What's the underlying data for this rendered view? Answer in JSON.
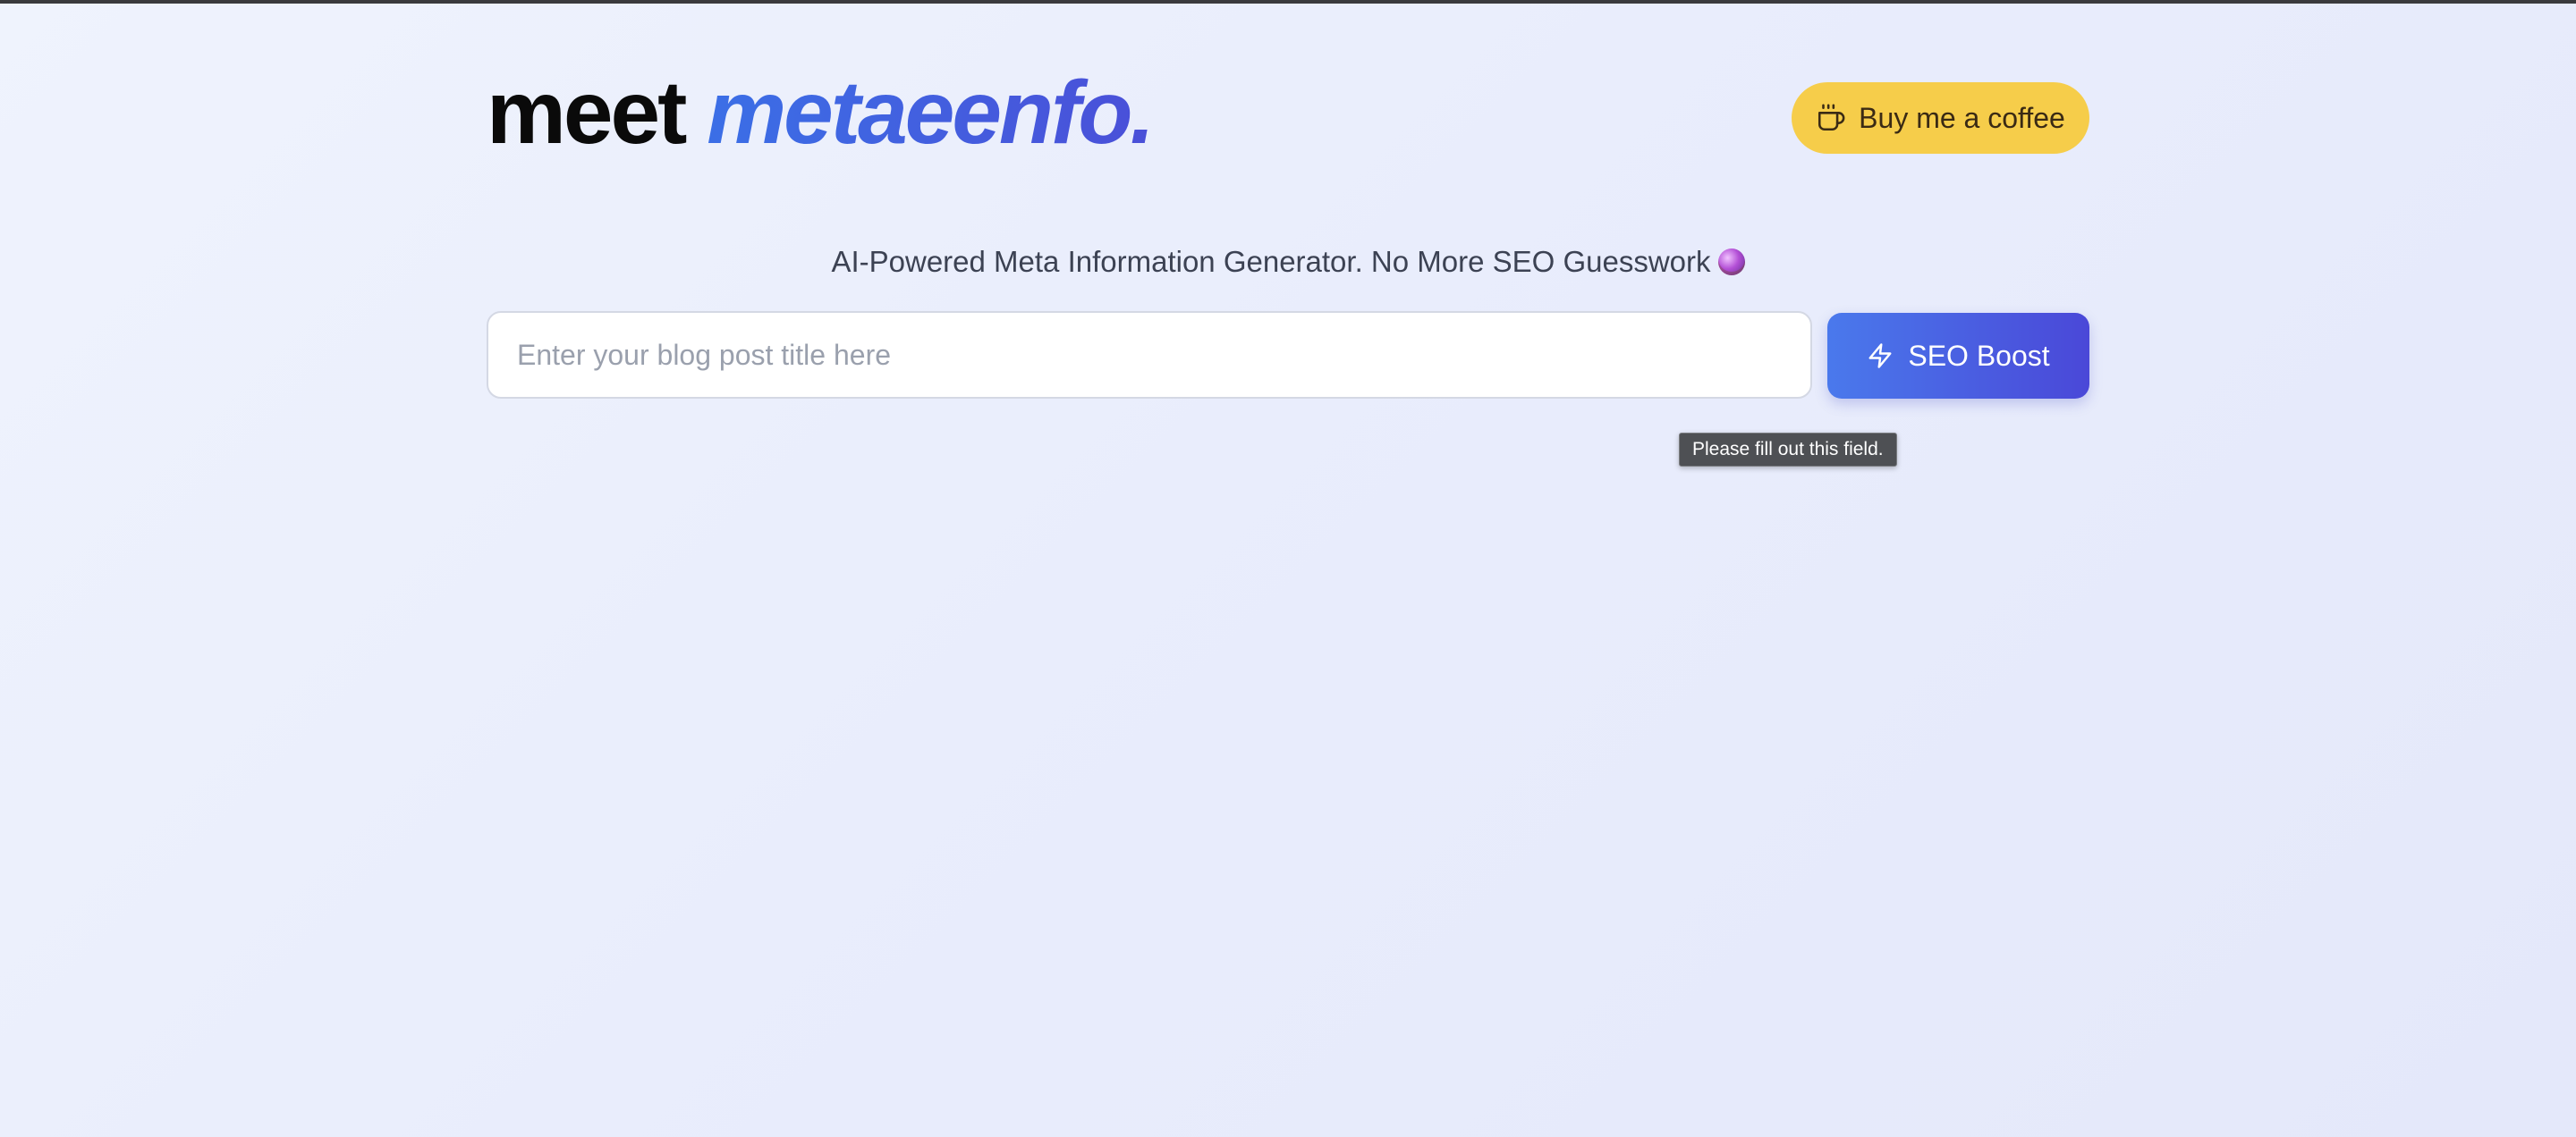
{
  "header": {
    "title_prefix": "meet",
    "title_brand": "metaeenfo.",
    "coffee_button": {
      "label": "Buy me a coffee",
      "icon": "coffee-cup-icon",
      "color": "#f6cd4a"
    }
  },
  "subtitle": {
    "text": "AI-Powered Meta Information Generator. No More SEO Guesswork",
    "icon": "crystal-ball-icon"
  },
  "form": {
    "input": {
      "value": "",
      "placeholder": "Enter your blog post title here"
    },
    "submit_button": {
      "label": "SEO Boost",
      "icon": "lightning-icon",
      "colors": [
        "#4a79ec",
        "#4a48d8"
      ]
    },
    "validation_tooltip": "Please fill out this field."
  },
  "theme": {
    "accent": "#3f5fe0",
    "background": "#eceffc"
  }
}
